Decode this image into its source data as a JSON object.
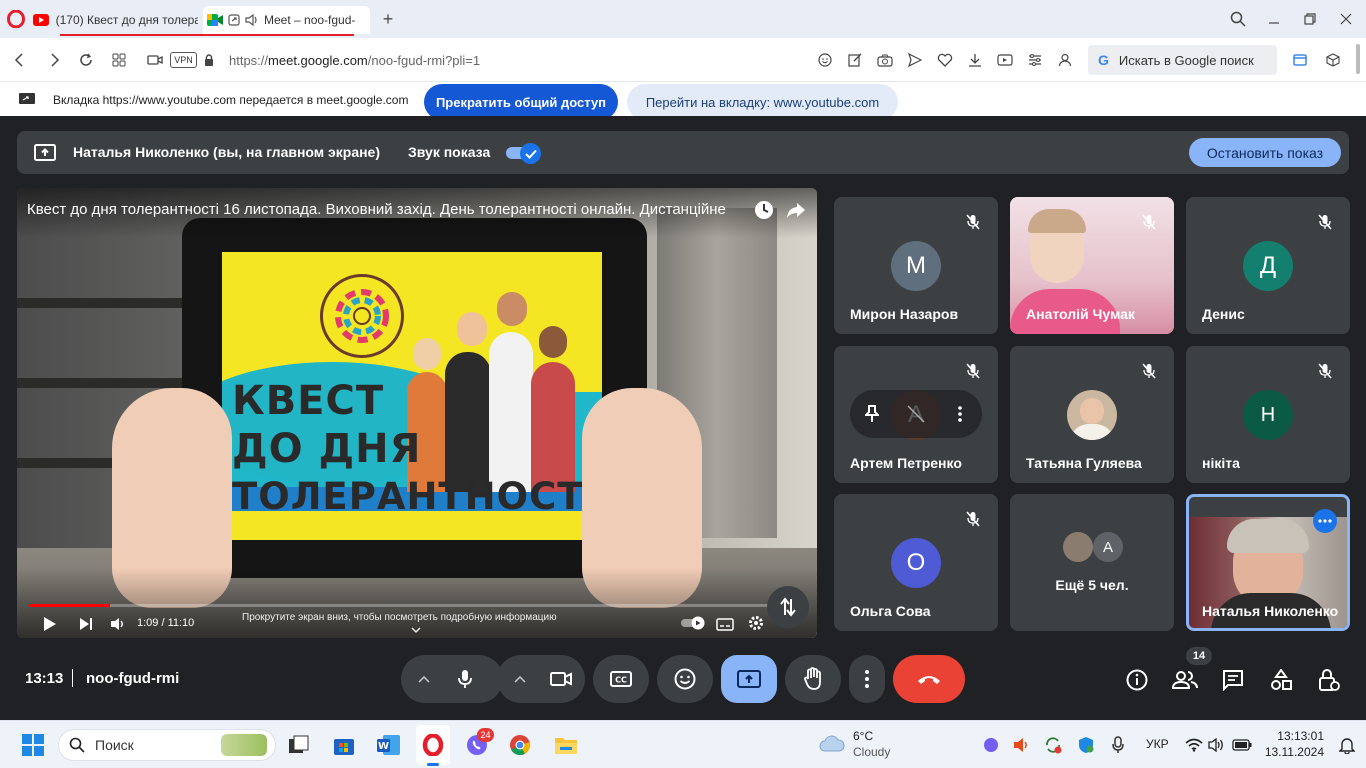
{
  "browser": {
    "tabs": [
      {
        "title": "(170) Квест до дня толера",
        "favicon": "youtube-icon"
      },
      {
        "title": "Meet – noo-fgud-",
        "favicon": "meet-icon"
      }
    ],
    "url_prefix": "https://",
    "url_domain": "meet.google.com",
    "url_path": "/noo-fgud-rmi?pli=1",
    "vpn_label": "VPN",
    "search_placeholder": "Искать в Google поиск"
  },
  "share_banner": {
    "text": "Вкладка https://www.youtube.com передается в meet.google.com",
    "stop_button": "Прекратить общий доступ",
    "goto_button": "Перейти на вкладку: www.youtube.com"
  },
  "meet": {
    "presenter_text": "Наталья Николенко (вы, на главном экране)",
    "sound_label": "Звук показа",
    "sound_on": true,
    "stop_share_button": "Остановить показ",
    "video": {
      "title": "Квест до дня толерантності 16 листопада. Виховний захід. День толерантності онлайн. Дистанційне",
      "time": "1:09 / 11:10",
      "scroll_hint": "Прокрутите экран вниз, чтобы посмотреть подробную информацию",
      "poster_line1": "КВЕСТ",
      "poster_line2": "ДО ДНЯ",
      "poster_line3": "ТОЛЕРАНТНОСТІ",
      "progress": 0.104
    },
    "participants": [
      {
        "name": "Мирон Назаров",
        "initial": "М",
        "color": "#5f6f7d",
        "muted": true
      },
      {
        "name": "Анатолій Чумак",
        "initial": "",
        "color": "",
        "muted": true
      },
      {
        "name": "Денис",
        "initial": "Д",
        "color": "#137f6e",
        "muted": true
      },
      {
        "name": "Артем Петренко",
        "initial": "А",
        "color": "#5f3a2c",
        "muted": true
      },
      {
        "name": "Татьяна Гуляева",
        "initial": "",
        "color": "",
        "muted": true
      },
      {
        "name": "нікіта",
        "initial": "Н",
        "color": "#0b5a43",
        "muted": true
      },
      {
        "name": "Ольга Сова",
        "initial": "О",
        "color": "#4f5bd5",
        "muted": true
      },
      {
        "name": "Ещё 5 чел.",
        "initial": "А",
        "color": "#5f6368",
        "muted": false
      },
      {
        "name": "Наталья Николенко",
        "initial": "",
        "color": "",
        "muted": false
      }
    ],
    "time": "13:13",
    "meeting_code": "noo-fgud-rmi",
    "people_count": "14"
  },
  "taskbar": {
    "search_label": "Поиск",
    "viber_badge": "24",
    "weather_temp": "6°C",
    "weather_desc": "Cloudy",
    "lang": "УКР",
    "clock_time": "13:13:01",
    "clock_date": "13.11.2024"
  },
  "colors": {
    "meet_bg": "#202124",
    "tile_bg": "#3c4043",
    "end_call": "#ea4335",
    "accent_blue": "#8ab4f8",
    "opera_red": "#e61e2b"
  }
}
